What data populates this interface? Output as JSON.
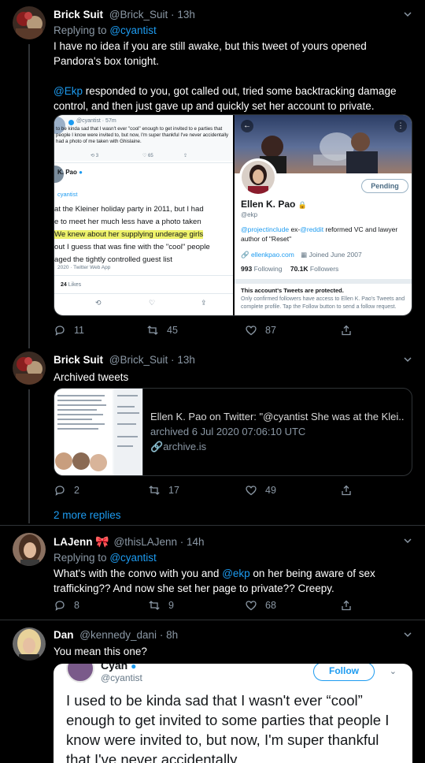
{
  "tweets": [
    {
      "name": "Brick Suit",
      "handle": "@Brick_Suit",
      "sep": "·",
      "time": "13h",
      "replying_prefix": "Replying to",
      "replying_to": "@cyantist",
      "body_p1": "I have no idea if you are still awake, but this tweet of yours opened Pandora's box tonight.",
      "body_mention": "@Ekp",
      "body_p2": " responded to you, got called out, tried some backtracking damage control, and then just gave up and quickly set her account to private.",
      "replies": "11",
      "retweets": "45",
      "likes": "87"
    },
    {
      "name": "Brick Suit",
      "handle": "@Brick_Suit",
      "sep": "·",
      "time": "13h",
      "body": "Archived tweets",
      "card_title": "Ellen K. Pao on Twitter: \"@cyantist She was at the Klei...",
      "card_desc": "archived 6 Jul 2020 07:06:10 UTC",
      "card_domain": "archive.is",
      "replies": "2",
      "retweets": "17",
      "likes": "49"
    },
    {
      "name": "LAJenn",
      "handle": "@thisLAJenn",
      "sep": "·",
      "time": "14h",
      "replying_prefix": "Replying to",
      "replying_to": "@cyantist",
      "body_a": "What's with the convo with you and ",
      "body_mention": "@ekp",
      "body_b": " on her being aware of sex trafficking?? And now she set her page to private?? Creepy.",
      "replies": "8",
      "retweets": "9",
      "likes": "68"
    },
    {
      "name": "Dan",
      "handle": "@kennedy_dani",
      "sep": "·",
      "time": "8h",
      "body": "You mean this one?"
    }
  ],
  "more_replies": "2 more replies",
  "left_shot": {
    "handle": "@cyantist · 57m",
    "preview": "to be kinda sad that I wasn't ever \"cool\" enough to get invited to e parties that people I know were invited to, but now, I'm super thankful I've never accidentally had a photo of me taken with Ghislaine.",
    "count1": "3",
    "count2": "65",
    "name_frag": "K. Pao",
    "handle_frag": "cyantist",
    "body1": "at the Kleiner holiday party in 2011, but I had",
    "body2": "e to meet her much less have a photo taken",
    "highlight": "We knew about her supplying underage girls",
    "body3": "out I guess that was fine with the \"cool\" people",
    "body4": "aged the tightly controlled guest list",
    "meta": "2020 · Twitter Web App",
    "likes_num": "24",
    "likes_label": "Likes"
  },
  "right_shot": {
    "pending": "Pending",
    "name": "Ellen K. Pao",
    "handle": "@ekp",
    "bio_link1": "@projectinclude",
    "bio_mid": " ex-",
    "bio_link2": "@reddit",
    "bio_rest": "  reformed VC and lawyer author of \"Reset\"",
    "url": "ellenkpao.com",
    "joined": "Joined June 2007",
    "following_num": "993",
    "following_label": "Following",
    "followers_num": "70.1K",
    "followers_label": "Followers",
    "protected_title": "This account's Tweets are protected.",
    "protected_body": "Only confirmed followers have access to Ellen K. Pao's Tweets and complete profile. Tap the Follow button to send a follow request."
  },
  "bottom_shot": {
    "name": "Cyan",
    "handle": "@cyantist",
    "follow": "Follow",
    "text": "I used to be kinda sad that I wasn't ever “cool” enough to get invited to some parties that people I know were invited to, but now, I'm super thankful that I've never accidentally"
  },
  "colors": {
    "bg": "#000000",
    "accent": "#1d9bf0",
    "muted": "#8b98a5",
    "divider": "#2f3336"
  }
}
